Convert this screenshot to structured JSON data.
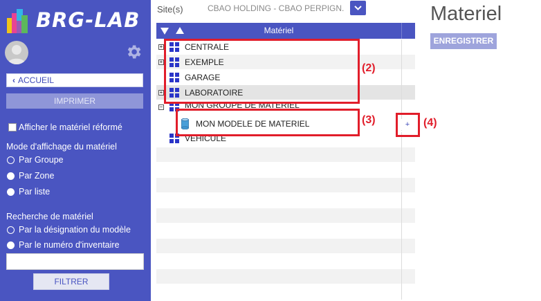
{
  "app": {
    "logo_text": "BRG-LAB"
  },
  "sidebar": {
    "home_label": "ACCUEIL",
    "print_label": "IMPRIMER",
    "show_retired_label": "Afficher le matériel réformé",
    "display_mode_title": "Mode d'affichage du matériel",
    "display_modes": [
      "Par Groupe",
      "Par Zone",
      "Par liste"
    ],
    "search_title": "Recherche de matériel",
    "search_modes": [
      "Par la désignation du modèle",
      "Par le numéro d'inventaire"
    ],
    "search_value": "",
    "filter_label": "FILTRER"
  },
  "site": {
    "label": "Site(s)",
    "value": "CBAO HOLDING - CBAO PERPIGN."
  },
  "tree": {
    "header": "Matériel",
    "rows": [
      "CENTRALE",
      "EXEMPLE",
      "GARAGE",
      "LABORATOIRE",
      "MON GROUPE DE MATERIEL",
      "MON MODELE DE MATERIEL",
      "VEHICULE"
    ],
    "add_symbol": "+"
  },
  "annotations": [
    "(2)",
    "(3)",
    "(4)"
  ],
  "page": {
    "title": "Materiel",
    "save_label": "ENREGISTRER"
  },
  "colors": {
    "sidebar": "#4a55c1",
    "annotation": "#e11d2a",
    "grid_icon": "#2a35c8"
  }
}
